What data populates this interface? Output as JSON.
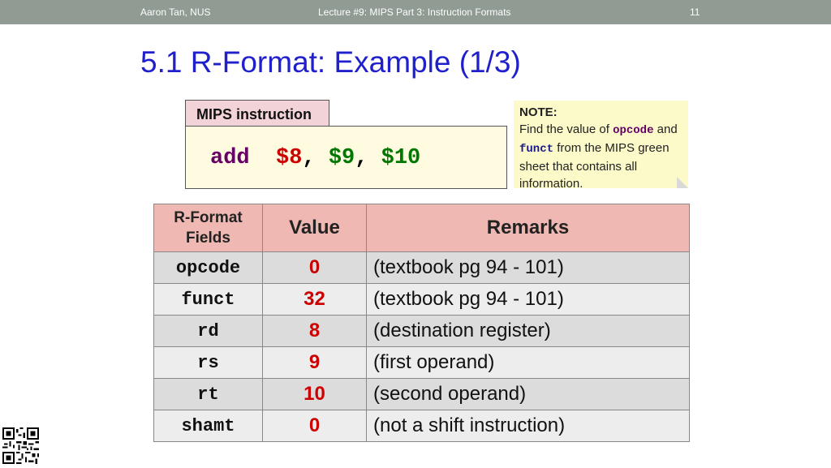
{
  "header": {
    "author": "Aaron Tan, NUS",
    "lecture": "Lecture #9: MIPS Part 3: Instruction Formats",
    "page": "11"
  },
  "title": "5.1 R-Format: Example (1/3)",
  "mips": {
    "tab_label": "MIPS instruction",
    "op": "add",
    "reg1": "$8",
    "reg2": "$9",
    "reg3": "$10",
    "sep": ","
  },
  "note": {
    "heading": "NOTE:",
    "line1": "Find the value of",
    "code1": "opcode",
    "and": "and",
    "code2": "funct",
    "rest": "from the MIPS green sheet that contains all information."
  },
  "table": {
    "headers": [
      "R-Format Fields",
      "Value",
      "Remarks"
    ],
    "rows": [
      {
        "field": "opcode",
        "value": "0",
        "remark": "(textbook pg 94 - 101)"
      },
      {
        "field": "funct",
        "value": "32",
        "remark": "(textbook pg 94 - 101)"
      },
      {
        "field": "rd",
        "value": "8",
        "remark": "(destination register)"
      },
      {
        "field": "rs",
        "value": "9",
        "remark": "(first operand)"
      },
      {
        "field": "rt",
        "value": "10",
        "remark": "(second operand)"
      },
      {
        "field": "shamt",
        "value": "0",
        "remark": "(not a shift instruction)"
      }
    ]
  },
  "colors": {
    "title": "#1f1fcc",
    "header_bar": "#8f9b93",
    "table_header": "#efb8b2",
    "value_red": "#cc0000",
    "op_purple": "#660066",
    "reg_green": "#007700"
  },
  "icons": {
    "qr": "qr-code-icon"
  }
}
